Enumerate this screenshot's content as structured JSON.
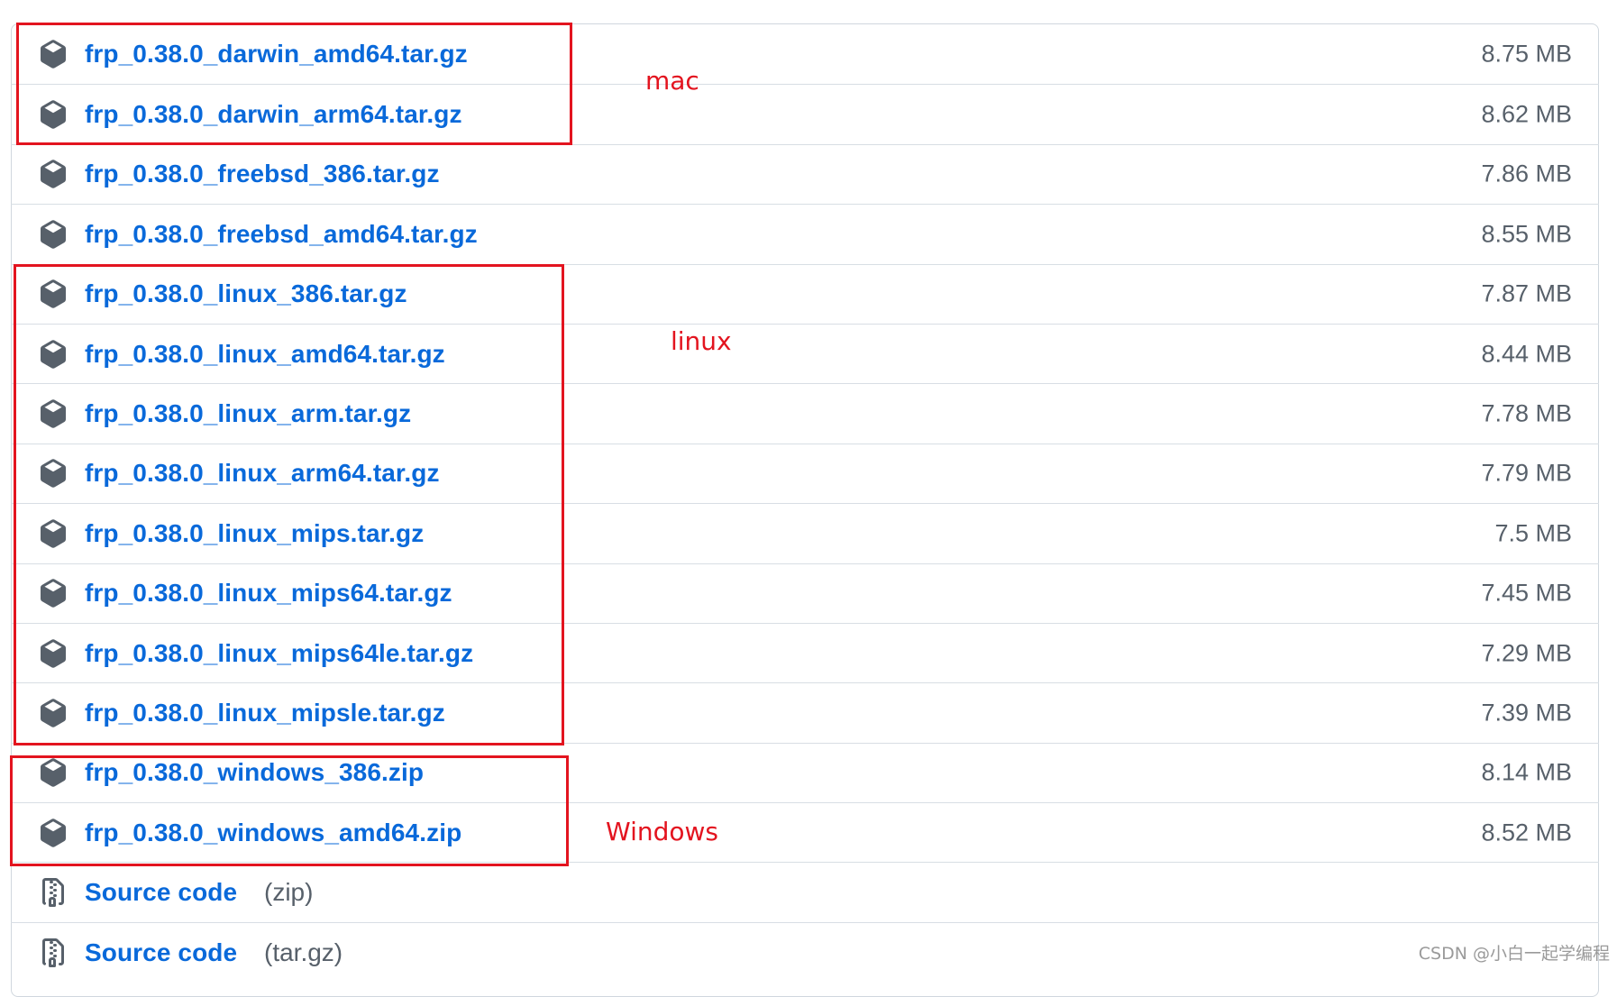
{
  "assets": [
    {
      "name": "frp_0.38.0_darwin_amd64.tar.gz",
      "size": "8.75 MB",
      "icon": "package-icon"
    },
    {
      "name": "frp_0.38.0_darwin_arm64.tar.gz",
      "size": "8.62 MB",
      "icon": "package-icon"
    },
    {
      "name": "frp_0.38.0_freebsd_386.tar.gz",
      "size": "7.86 MB",
      "icon": "package-icon"
    },
    {
      "name": "frp_0.38.0_freebsd_amd64.tar.gz",
      "size": "8.55 MB",
      "icon": "package-icon"
    },
    {
      "name": "frp_0.38.0_linux_386.tar.gz",
      "size": "7.87 MB",
      "icon": "package-icon"
    },
    {
      "name": "frp_0.38.0_linux_amd64.tar.gz",
      "size": "8.44 MB",
      "icon": "package-icon"
    },
    {
      "name": "frp_0.38.0_linux_arm.tar.gz",
      "size": "7.78 MB",
      "icon": "package-icon"
    },
    {
      "name": "frp_0.38.0_linux_arm64.tar.gz",
      "size": "7.79 MB",
      "icon": "package-icon"
    },
    {
      "name": "frp_0.38.0_linux_mips.tar.gz",
      "size": "7.5 MB",
      "icon": "package-icon"
    },
    {
      "name": "frp_0.38.0_linux_mips64.tar.gz",
      "size": "7.45 MB",
      "icon": "package-icon"
    },
    {
      "name": "frp_0.38.0_linux_mips64le.tar.gz",
      "size": "7.29 MB",
      "icon": "package-icon"
    },
    {
      "name": "frp_0.38.0_linux_mipsle.tar.gz",
      "size": "7.39 MB",
      "icon": "package-icon"
    },
    {
      "name": "frp_0.38.0_windows_386.zip",
      "size": "8.14 MB",
      "icon": "package-icon"
    },
    {
      "name": "frp_0.38.0_windows_amd64.zip",
      "size": "8.52 MB",
      "icon": "package-icon"
    }
  ],
  "source_code": [
    {
      "label": "Source code",
      "format": "(zip)",
      "icon": "file-zip-icon"
    },
    {
      "label": "Source code",
      "format": "(tar.gz)",
      "icon": "file-zip-icon"
    }
  ],
  "annotations": {
    "mac": "mac",
    "linux": "linux",
    "windows": "Windows"
  },
  "watermark": "CSDN @小白一起学编程",
  "colors": {
    "link": "#0969da",
    "muted": "#57606a",
    "annotation": "#e3141f",
    "border": "#d0d7de"
  }
}
